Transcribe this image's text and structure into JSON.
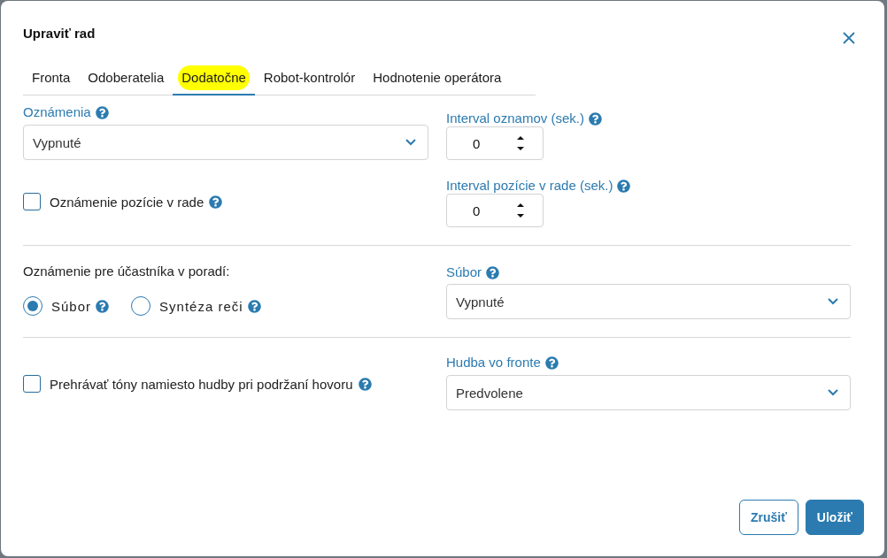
{
  "dialog": {
    "title": "Upraviť rad"
  },
  "tabs": [
    {
      "label": "Fronta",
      "selected": false,
      "highlighted": false
    },
    {
      "label": "Odoberatelia",
      "selected": false,
      "highlighted": false
    },
    {
      "label": "Dodatočne",
      "selected": true,
      "highlighted": true
    },
    {
      "label": "Robot-kontrolór",
      "selected": false,
      "highlighted": false
    },
    {
      "label": "Hodnotenie operátora",
      "selected": false,
      "highlighted": false
    }
  ],
  "announcements": {
    "label": "Oznámenia",
    "value": "Vypnuté"
  },
  "announcement_interval": {
    "label": "Interval oznamov (sek.)",
    "value": "0"
  },
  "position_announcement": {
    "label": "Oznámenie pozície v rade",
    "checked": false
  },
  "position_interval": {
    "label": "Interval pozície v rade (sek.)",
    "value": "0"
  },
  "participant_announcement": {
    "label": "Oznámenie pre účastníka v poradí:",
    "options": [
      {
        "label": "Súbor",
        "selected": true
      },
      {
        "label": "Syntéza reči",
        "selected": false
      }
    ]
  },
  "file": {
    "label": "Súbor",
    "value": "Vypnuté"
  },
  "play_tones": {
    "label": "Prehrávať tóny namiesto hudby pri podržaní hovoru",
    "checked": false
  },
  "queue_music": {
    "label": "Hudba vo fronte",
    "value": "Predvolene"
  },
  "buttons": [
    {
      "label": "Zrušiť",
      "kind": "secondary"
    },
    {
      "label": "Uložiť",
      "kind": "primary"
    }
  ]
}
